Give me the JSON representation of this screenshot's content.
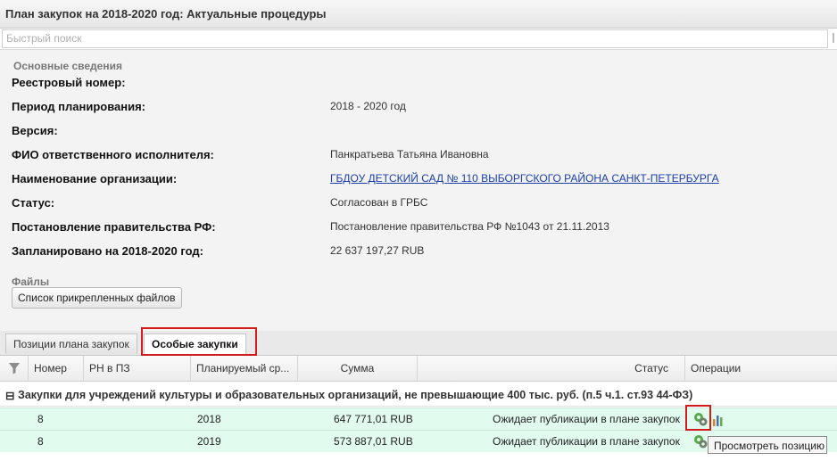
{
  "window": {
    "title": "План закупок на 2018-2020 год: Актуальные процедуры"
  },
  "search": {
    "placeholder": "Быстрый поиск"
  },
  "info": {
    "section_title": "Основные сведения",
    "fields": [
      {
        "label": "Реестровый номер:",
        "value": ""
      },
      {
        "label": "Период планирования:",
        "value": "2018 - 2020 год"
      },
      {
        "label": "Версия:",
        "value": ""
      },
      {
        "label": "ФИО ответственного исполнителя:",
        "value": "Панкратьева Татьяна Ивановна"
      },
      {
        "label": "Наименование организации:",
        "value": "ГБДОУ ДЕТСКИЙ САД № 110 ВЫБОРГСКОГО РАЙОНА САНКТ-ПЕТЕРБУРГА"
      },
      {
        "label": "Статус:",
        "value": "Согласован в ГРБС"
      },
      {
        "label": "Постановление правительства РФ:",
        "value": "Постановление правительства РФ №1043 от 21.11.2013"
      },
      {
        "label": "Запланировано на 2018-2020 год:",
        "value": "22 637 197,27 RUB"
      }
    ]
  },
  "files": {
    "section_title": "Файлы",
    "button_label": "Список прикрепленных файлов"
  },
  "tabs": [
    {
      "label": "Позиции плана закупок",
      "active": false
    },
    {
      "label": "Особые закупки",
      "active": true
    }
  ],
  "grid": {
    "columns": [
      "Номер",
      "РН в ПЗ",
      "Планируемый ср...",
      "Сумма",
      "Статус",
      "Операции"
    ],
    "group_label": "Закупки для учреждений культуры и образовательных организаций, не превышающие 400 тыс. руб. (п.5 ч.1. ст.93 44-ФЗ)",
    "rows": [
      {
        "number": "8",
        "rn": "",
        "planned": "2018",
        "sum": "647 771,01 RUB",
        "status": "Ожидает публикации в плане закупок"
      },
      {
        "number": "8",
        "rn": "",
        "planned": "2019",
        "sum": "573 887,01 RUB",
        "status": "Ожидает публикации в плане закупок"
      }
    ]
  },
  "tooltip": {
    "text": "Просмотреть позицию"
  },
  "colors": {
    "highlight": "#d21c1c",
    "row_bg": "#e2fbef",
    "link": "#1b3fa8"
  }
}
